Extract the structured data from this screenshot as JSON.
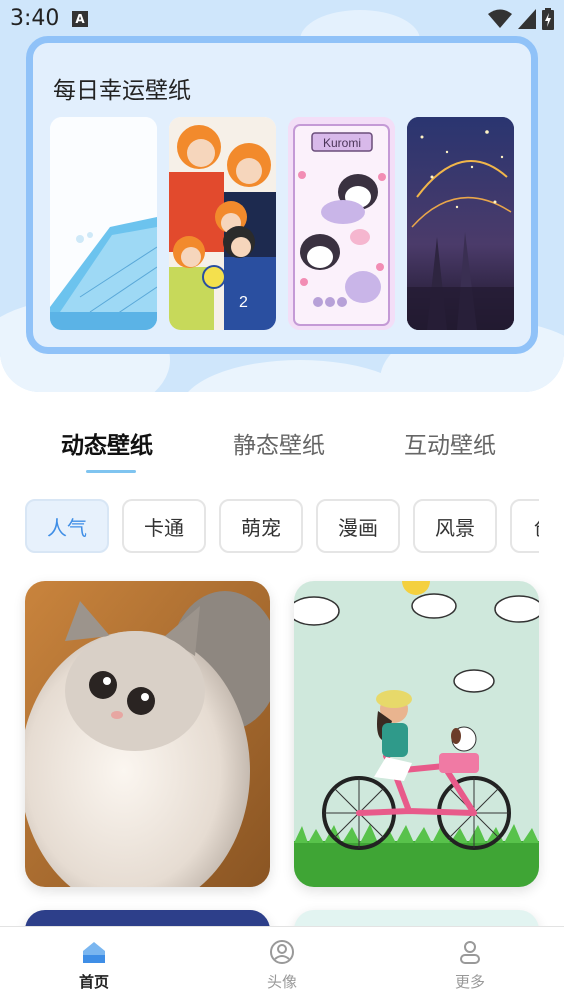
{
  "status_bar": {
    "time": "3:40",
    "notification_icon": "A"
  },
  "lucky": {
    "title": "每日幸运壁纸"
  },
  "tabs": [
    {
      "label": "动态壁纸",
      "active": true
    },
    {
      "label": "静态壁纸",
      "active": false
    },
    {
      "label": "互动壁纸",
      "active": false
    }
  ],
  "categories": [
    {
      "label": "人气",
      "active": true
    },
    {
      "label": "卡通",
      "active": false
    },
    {
      "label": "萌宠",
      "active": false
    },
    {
      "label": "漫画",
      "active": false
    },
    {
      "label": "风景",
      "active": false
    },
    {
      "label": "创",
      "active": false
    }
  ],
  "lucky_wallpapers": [
    "pool-wallpaper",
    "anime-volleyball-wallpaper",
    "kuromi-wallpaper",
    "starry-night-wallpaper"
  ],
  "kuromi_text": "Kuromi",
  "feed": [
    "fluffy-kitten-wallpaper",
    "bicycle-girl-dog-wallpaper"
  ],
  "bottom_nav": [
    {
      "label": "首页",
      "icon": "home-icon",
      "active": true
    },
    {
      "label": "头像",
      "icon": "avatar-icon",
      "active": false
    },
    {
      "label": "更多",
      "icon": "more-user-icon",
      "active": false
    }
  ],
  "colors": {
    "accent": "#3f8ee6",
    "hero_bg": "#cfe6fb",
    "card_border": "#90c2f8",
    "underline": "#7fc4f0"
  }
}
